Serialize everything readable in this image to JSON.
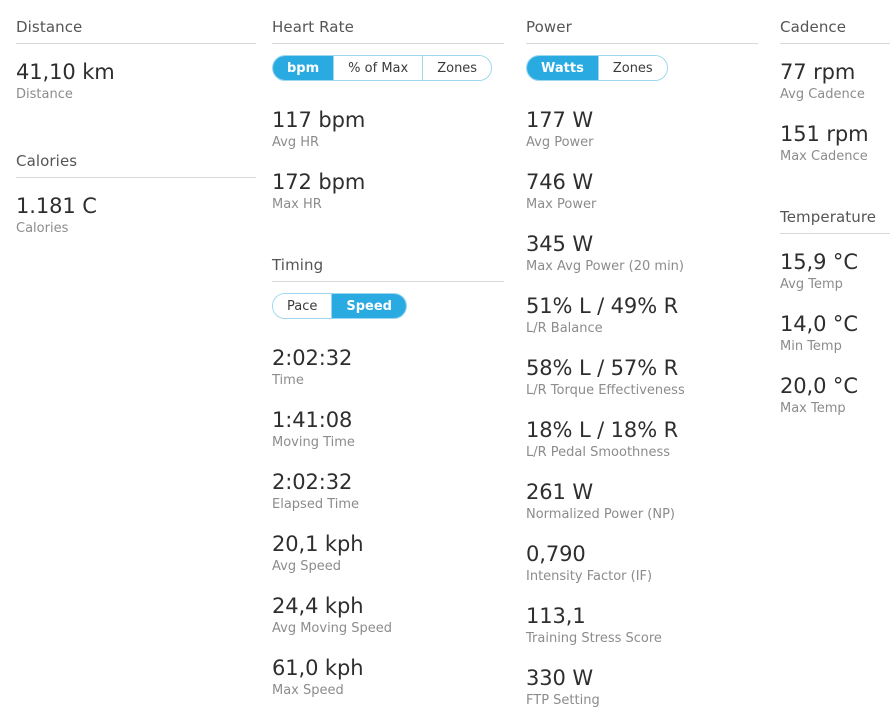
{
  "accent_color": "#29abe2",
  "columns": {
    "distance": {
      "sections": [
        {
          "header": "Distance",
          "stats": [
            {
              "value": "41,10 km",
              "label": "Distance"
            }
          ]
        },
        {
          "header": "Calories",
          "stats": [
            {
              "value": "1.181 C",
              "label": "Calories"
            }
          ]
        }
      ]
    },
    "heartrate": {
      "sections": [
        {
          "header": "Heart Rate",
          "toggle": {
            "name": "heart-rate-unit-toggle",
            "options": [
              "bpm",
              "% of Max",
              "Zones"
            ],
            "selected": "bpm"
          },
          "stats": [
            {
              "value": "117 bpm",
              "label": "Avg HR"
            },
            {
              "value": "172 bpm",
              "label": "Max HR"
            }
          ]
        },
        {
          "header": "Timing",
          "toggle": {
            "name": "timing-unit-toggle",
            "options": [
              "Pace",
              "Speed"
            ],
            "selected": "Speed"
          },
          "stats": [
            {
              "value": "2:02:32",
              "label": "Time"
            },
            {
              "value": "1:41:08",
              "label": "Moving Time"
            },
            {
              "value": "2:02:32",
              "label": "Elapsed Time"
            },
            {
              "value": "20,1 kph",
              "label": "Avg Speed"
            },
            {
              "value": "24,4 kph",
              "label": "Avg Moving Speed"
            },
            {
              "value": "61,0 kph",
              "label": "Max Speed"
            }
          ]
        }
      ]
    },
    "power": {
      "sections": [
        {
          "header": "Power",
          "toggle": {
            "name": "power-unit-toggle",
            "options": [
              "Watts",
              "Zones"
            ],
            "selected": "Watts"
          },
          "stats": [
            {
              "value": "177 W",
              "label": "Avg Power"
            },
            {
              "value": "746 W",
              "label": "Max Power"
            },
            {
              "value": "345 W",
              "label": "Max Avg Power (20 min)"
            },
            {
              "value": "51% L / 49% R",
              "label": "L/R Balance"
            },
            {
              "value": "58% L / 57% R",
              "label": "L/R Torque Effectiveness"
            },
            {
              "value": "18% L / 18% R",
              "label": "L/R Pedal Smoothness"
            },
            {
              "value": "261 W",
              "label": "Normalized Power (NP)"
            },
            {
              "value": "0,790",
              "label": "Intensity Factor (IF)"
            },
            {
              "value": "113,1",
              "label": "Training Stress Score"
            },
            {
              "value": "330 W",
              "label": "FTP Setting"
            }
          ]
        }
      ]
    },
    "cadence": {
      "sections": [
        {
          "header": "Cadence",
          "stats": [
            {
              "value": "77 rpm",
              "label": "Avg Cadence"
            },
            {
              "value": "151 rpm",
              "label": "Max Cadence"
            }
          ]
        },
        {
          "header": "Temperature",
          "stats": [
            {
              "value": "15,9 °C",
              "label": "Avg Temp"
            },
            {
              "value": "14,0 °C",
              "label": "Min Temp"
            },
            {
              "value": "20,0 °C",
              "label": "Max Temp"
            }
          ]
        }
      ]
    }
  }
}
